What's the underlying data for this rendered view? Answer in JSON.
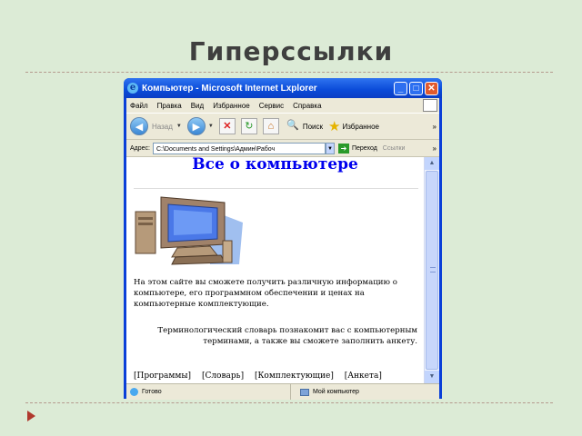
{
  "slide": {
    "title": "Гиперссылки"
  },
  "window": {
    "title": "Компьютер - Microsoft Internet Lxplorer",
    "menu": [
      "Файл",
      "Правка",
      "Вид",
      "Избранное",
      "Сервис",
      "Справка"
    ],
    "toolbar": {
      "back_label": "Назад",
      "search_label": "Поиск",
      "favorites_label": "Избранное",
      "more": "»"
    },
    "address": {
      "label": "Адрес:",
      "value": "C:\\Documents and Settings\\Админ\\Рабоч",
      "go_label": "Переход",
      "links_label": "Ссылки",
      "more": "»"
    },
    "status": {
      "left": "Готово",
      "right": "Мой компьютер"
    }
  },
  "document": {
    "heading": "Все о компьютере",
    "paragraph1": "На этом сайте вы сможете получить различную информацию о компьютере, его программном обеспечении и ценах на компьютерные комплектующие.",
    "paragraph2": "Терминологический словарь познакомит вас с компьютерным терминами, а также вы сможете заполнить анкету.",
    "links": [
      "[Программы]",
      "[Словарь]",
      "[Комплектующие]",
      "[Анкета]"
    ]
  },
  "colors": {
    "background": "#dcebd6",
    "title_bar": "#0a4ad8",
    "link_heading": "#0000ee",
    "bullet": "#b0392e"
  }
}
